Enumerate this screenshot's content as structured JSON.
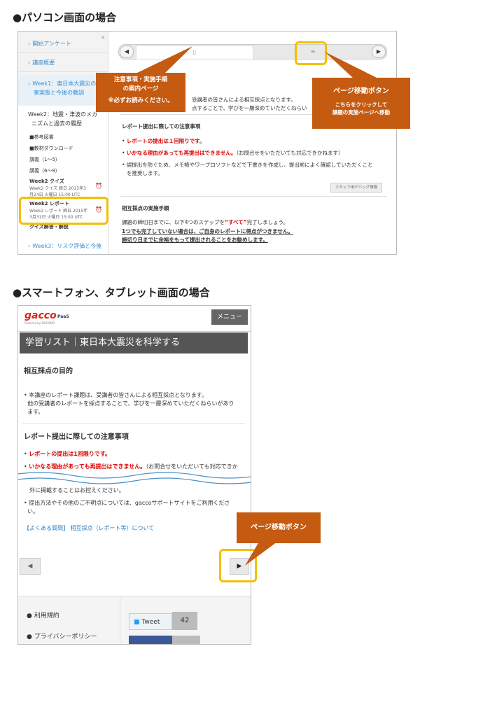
{
  "pc_heading": "●パソコン画面の場合",
  "sp_heading": "●スマートフォン、タブレット画面の場合",
  "pc": {
    "sidebar_collapse": "«",
    "sidebar": {
      "item1": "開始アンケート",
      "item2": "講座概要",
      "week1_line1": "Week1：東日本大震災の被",
      "week1_line2": "害実態と今後の教訓",
      "week2_line1": "Week2：地震・津波のメカ",
      "week2_line2": "ニズムと過去の履歴",
      "sub1": "■参考図書",
      "sub2": "■教材ダウンロード",
      "sub3": "講義（1〜5）",
      "sub4": "講義（6〜8）",
      "quiz_title": "Week2 クイズ",
      "quiz_date1": "Week2 クイズ 締日 2015年3",
      "quiz_date2": "月24日 火曜日 15:00 UTC",
      "report_title": "Week2 レポート",
      "report_date1": "Week2 レポート 締日 2015年",
      "report_date2": "3月31日 火曜日 15:00 UTC",
      "quiz_answer": "クイズ解答・解説",
      "week3": "Week3：リスク評価と今後"
    },
    "nav": {
      "prev": "◀",
      "next": "▶",
      "page_icon": "▯",
      "list_icon": "≡"
    },
    "body": {
      "line1": "受講者の皆さんによる相互採点となります。",
      "line2": "点することで、学びを一層深めていただくねらい",
      "section1": "レポート提出に際しての注意事項",
      "b1": "レポートの提出は１回限りです。",
      "b2_red": "いかなる理由があっても再提出はできません。",
      "b2_rest": "（お問合せをいただいても対応できかねます）",
      "b3_line1": "誤提出を防ぐため、メモ帳やワープロソフトなどで下書きを作成し、提出前によく確認していただくこと",
      "b3_line2": "を推奨します。",
      "staff_button": "スタッフ用デバッグ情報",
      "section2": "相互採点の実施手順",
      "p1_a": "課題の締切日までに、以下4つのステップを",
      "p1_red": "“すべて”",
      "p1_b": "完了しましょう。",
      "p2": "1つでも完了していない場合は、ご自身のレポートに得点がつきません。",
      "p3": "締切り日までに余裕をもって提出されることをお勧めします。"
    },
    "callout_left": {
      "l1": "注意事項・実施手順",
      "l2": "の案内ページ",
      "l3": "※必ずお読みください。"
    },
    "callout_right": {
      "title": "ページ移動ボタン",
      "l1": "こちらをクリックして",
      "l2": "課題の実施ページへ移動"
    }
  },
  "sp": {
    "logo": "gacco",
    "logo_sub": "Powered by DOCOMO",
    "logo_mark": "PaaS",
    "menu": "メニュー",
    "title": "学習リスト｜東日本大震災を科学する",
    "section1": "相互採点の目的",
    "p1_l1": "本講座のレポート課題は、受講者の皆さんによる相互採点となります。",
    "p1_l2": "他の受講者のレポートを採点することで、学びを一層深めていただくねらいがあり",
    "p1_l3": "ます。",
    "section2": "レポート提出に際しての注意事項",
    "b1": "レポートの提出は1回限りです。",
    "b2_red": "いかなる理由があっても再提出はできません。",
    "b2_rest": "（お問合せをいただいても対応できか",
    "c1": "外に掲載することはお控えください。",
    "c2_l1": "提出方法やその他のご不明点については、gaccoサポートサイトをご利用くださ",
    "c2_l2": "い。",
    "faq": "【よくある質問】 相互採点（レポート等）について",
    "prev": "◀",
    "next": "▶",
    "callout": "ページ移動ボタン",
    "footer_terms": "利用規約",
    "footer_privacy": "プライバシーポリシー",
    "tweet": "Tweet",
    "tweet_count": "42"
  },
  "colors": {
    "accent_callout": "#c55a11",
    "highlight": "#f2c000",
    "link": "#3b8ed0"
  }
}
